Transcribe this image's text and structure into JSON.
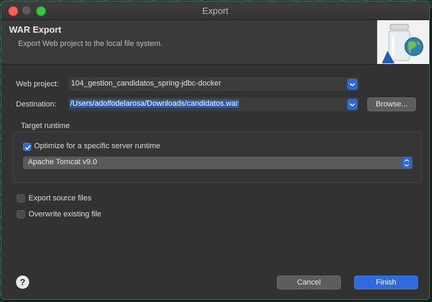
{
  "window": {
    "title": "Export"
  },
  "banner": {
    "title": "WAR Export",
    "description": "Export Web project to the local file system.",
    "image_icon": "jar-globe-icon"
  },
  "form": {
    "web_project_label": "Web project:",
    "web_project_value": "104_gestion_candidatos_spring-jdbc-docker",
    "destination_label": "Destination:",
    "destination_value": "/Users/adolfodelarosa/Downloads/candidatos.war",
    "browse_label": "Browse..."
  },
  "target_runtime": {
    "group_label": "Target runtime",
    "optimize_label": "Optimize for a specific server runtime",
    "optimize_checked": true,
    "runtime_value": "Apache Tomcat v9.0"
  },
  "options": {
    "export_source_label": "Export source files",
    "export_source_checked": false,
    "overwrite_label": "Overwrite existing file",
    "overwrite_checked": false
  },
  "footer": {
    "help_symbol": "?",
    "cancel_label": "Cancel",
    "finish_label": "Finish"
  },
  "colors": {
    "accent": "#2c68d8",
    "window_bg": "#323232",
    "close_light": "#fd5f57",
    "max_light": "#2dc942"
  }
}
